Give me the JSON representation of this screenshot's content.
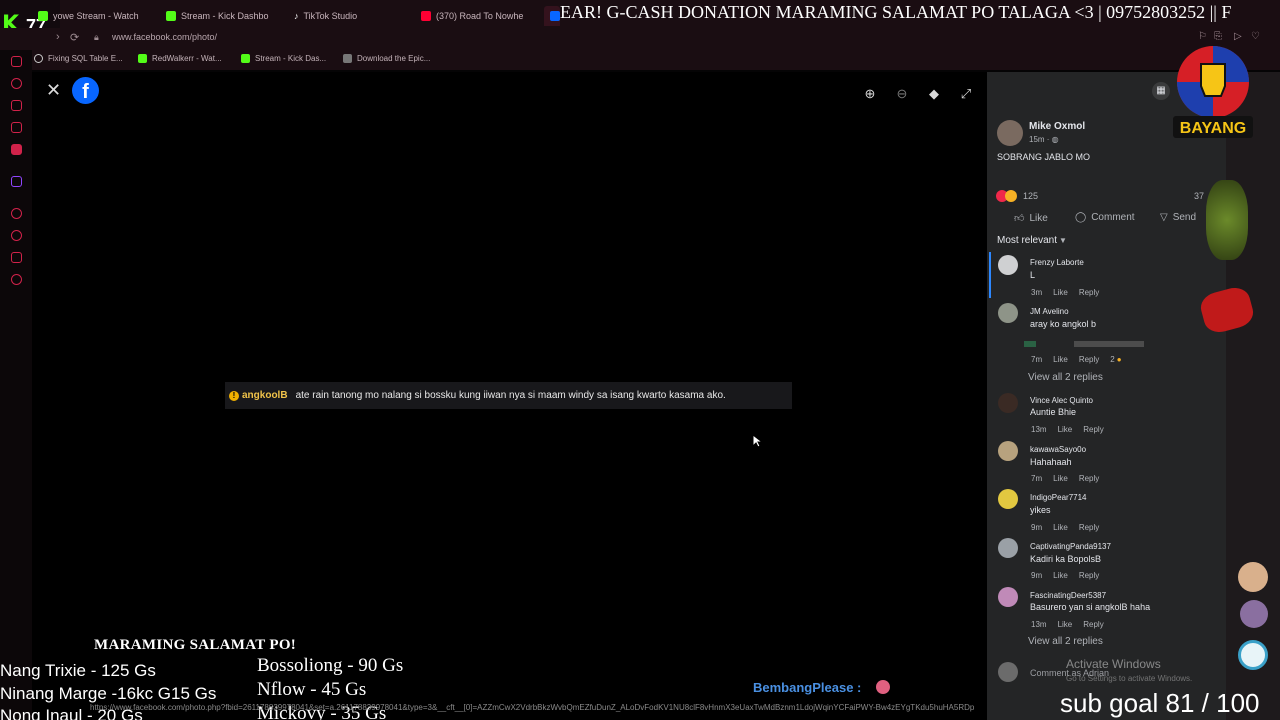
{
  "browser": {
    "viewer_count": "77",
    "tabs": [
      {
        "label": "yowe Stream - Watch"
      },
      {
        "label": "Stream - Kick Dashbo"
      },
      {
        "label": "TikTok Studio"
      },
      {
        "label": "(370) Road To Nowhe"
      }
    ],
    "url": "www.facebook.com/photo/",
    "bookmarks": [
      {
        "label": "Fixing SQL Table E..."
      },
      {
        "label": "RedWalkerr - Wat..."
      },
      {
        "label": "Stream - Kick Das..."
      },
      {
        "label": "Download the Epic..."
      }
    ]
  },
  "donation_marquee": "EAR! G-CASH DONATION MARAMING SALAMAT PO TALAGA <3  | 09752803252 || F",
  "stream_chat": {
    "username": "angkoolB",
    "message": "ate rain tanong mo nalang si bossku kung iiwan nya si maam windy sa isang kwarto kasama ako."
  },
  "post": {
    "author": "Mike Oxmol",
    "time": "15m",
    "text": "SOBRANG JABLO MO",
    "reaction_count": "125",
    "comment_count": "37",
    "actions": {
      "like": "Like",
      "comment": "Comment",
      "send": "Send"
    },
    "sort": "Most relevant"
  },
  "comments": [
    {
      "name": "Frenzy Laborte",
      "text": "L",
      "time": "3m",
      "like": "Like",
      "reply": "Reply"
    },
    {
      "name": "JM Avelino",
      "text": "aray ko angkol b",
      "time": "7m",
      "like": "Like",
      "reply": "Reply",
      "reactions": "2"
    },
    {
      "name": "Vince Alec Quinto",
      "text": "Auntie Bhie",
      "time": "13m",
      "like": "Like",
      "reply": "Reply"
    },
    {
      "name": "kawawaSayo0o",
      "text": "Hahahaah",
      "time": "7m",
      "like": "Like",
      "reply": "Reply"
    },
    {
      "name": "IndigoPear7714",
      "text": "yikes",
      "time": "9m",
      "like": "Like",
      "reply": "Reply"
    },
    {
      "name": "CaptivatingPanda9137",
      "text": "Kadiri ka BopolsB",
      "time": "9m",
      "like": "Like",
      "reply": "Reply"
    },
    {
      "name": "FascinatingDeer5387",
      "text": "Basurero yan si angkolB haha",
      "time": "13m",
      "like": "Like",
      "reply": "Reply"
    }
  ],
  "view_replies": [
    "View all 2 replies",
    "View all 2 replies"
  ],
  "comment_as": "Comment as Adrian",
  "watermark": {
    "title": "Activate Windows",
    "subtitle": "Go to Settings to activate Windows."
  },
  "overlay": {
    "brand": "BAYANG",
    "thanks": "MARAMING SALAMAT PO!",
    "donors_left": [
      "Nang Trixie - 125 Gs",
      "Ninang Marge -16kc G15 Gs",
      "Nong Inaul - 20 Gs"
    ],
    "donors_right": [
      "Bossoliong - 90 Gs",
      "Nflow - 45 Gs",
      "Mickovy - 35 Gs"
    ],
    "chat_name": "BembangPlease :",
    "sub_goal": "sub goal 81 / 100",
    "status_url": "https://www.facebook.com/photo.php?fbid=261178839978041&set=a.261178839978041&type=3&__cft__[0]=AZZmCwX2VdrbBkzWvbQmEZfuDunZ_ALoDvFodKV1NU8clF8vHnmX3eUaxTwMdBznm1LdojWqinYCFaiPWY-Bw4zEYgTKdu5huHA5RDp"
  },
  "colors": {
    "facebook_blue": "#0866ff",
    "kick_green": "#53fc18",
    "panel_bg": "#242526",
    "link_blue": "#2d88ff"
  }
}
